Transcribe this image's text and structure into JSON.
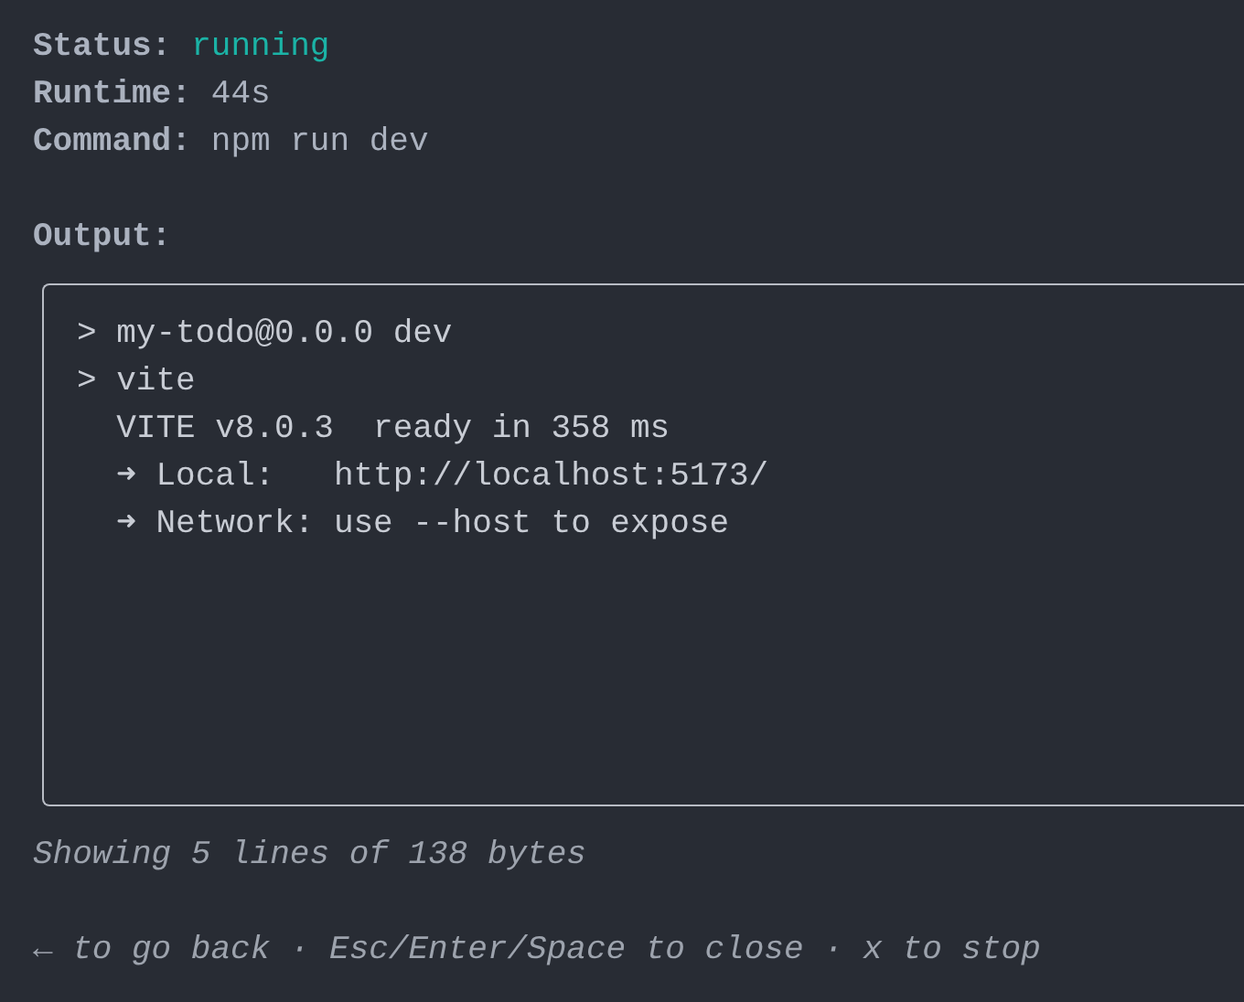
{
  "fields": [
    {
      "label": "Status:",
      "value": "running",
      "color": "#1bb3a6"
    },
    {
      "label": "Runtime:",
      "value": "44s"
    },
    {
      "label": "Command:",
      "value": "npm run dev"
    }
  ],
  "output": {
    "label": "Output:",
    "lines": [
      "> my-todo@0.0.0 dev",
      "> vite",
      "  VITE v8.0.3  ready in 358 ms",
      "  ➜ Local:   http://localhost:5173/",
      "  ➜ Network: use --host to expose"
    ]
  },
  "summary": "Showing 5 lines of 138 bytes",
  "hint": "← to go back · Esc/Enter/Space to close · x to stop"
}
